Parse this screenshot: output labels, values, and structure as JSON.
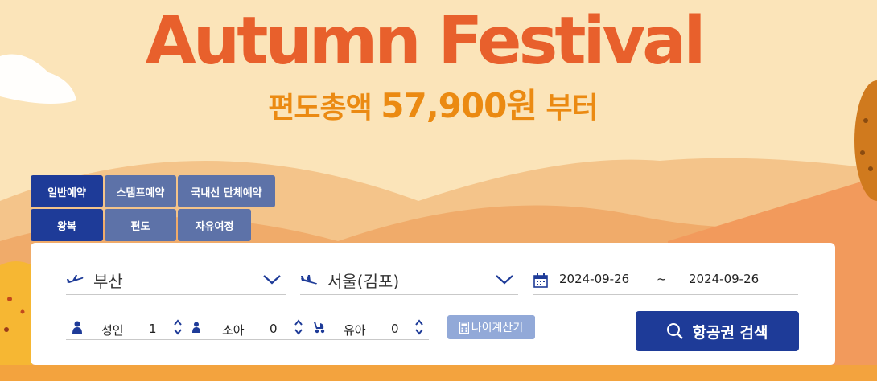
{
  "banner": {
    "title": "Autumn Festival",
    "subtitle_prefix": "편도총액",
    "subtitle_price": "57,900원",
    "subtitle_suffix": "부터"
  },
  "booking_tabs": [
    "일반예약",
    "스탬프예약",
    "국내선 단체예약"
  ],
  "trip_tabs": [
    "왕복",
    "편도",
    "자유여정"
  ],
  "search": {
    "origin": "부산",
    "destination": "서울(김포)",
    "depart_date": "2024-09-26",
    "date_separator": "~",
    "return_date": "2024-09-26",
    "adult_label": "성인",
    "adult_count": "1",
    "child_label": "소아",
    "child_count": "0",
    "infant_label": "유아",
    "infant_count": "0",
    "age_calc_label": "나이계산기",
    "search_button": "항공권 검색"
  },
  "colors": {
    "title": "#e8602c",
    "subtitle": "#eb8a12",
    "primary": "#1e3b98",
    "tab_inactive": "#5d72a8",
    "age_calc": "#92a9d8"
  },
  "icons": [
    "plane-takeoff-icon",
    "plane-landing-icon",
    "chevron-down-icon",
    "calendar-icon",
    "person-icon",
    "stroller-icon",
    "calculator-icon",
    "search-icon"
  ]
}
